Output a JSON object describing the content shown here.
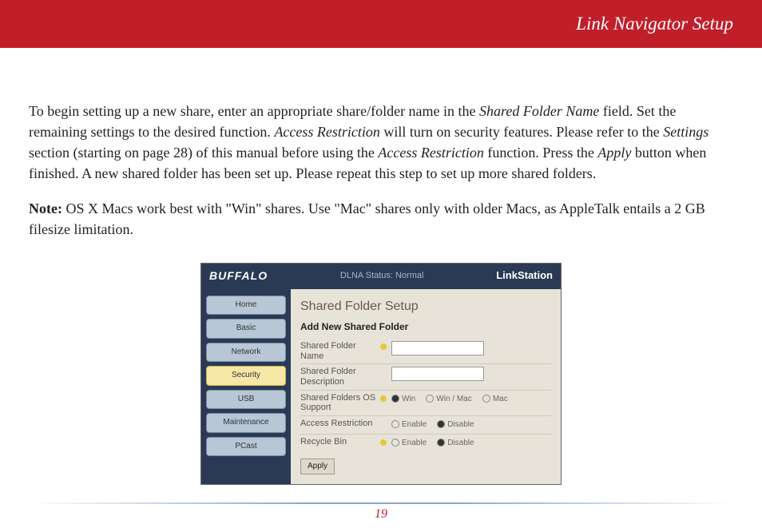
{
  "header": {
    "title": "Link Navigator Setup"
  },
  "body": {
    "p1a": "To begin setting up a new share, enter an appropriate share/folder name in the ",
    "p1_em1": "Shared Folder Name",
    "p1b": " field.   Set the remaining settings to the desired function.  ",
    "p1_em2": "Access Restriction",
    "p1c": " will turn on security features.  Please refer to the ",
    "p1_em3": "Settings",
    "p1d": " section (starting on page 28) of this manual before using the ",
    "p1_em4": "Access Restriction",
    "p1e": " function.  Press the ",
    "p1_em5": "Apply",
    "p1f": " button when finished.  A new shared folder has been set up.  Please repeat this step to set up more shared folders.",
    "note_label": "Note:",
    "note_text": "  OS X Macs work best with \"Win\" shares.  Use \"Mac\" shares only with older Macs, as AppleTalk entails a 2 GB filesize limitation."
  },
  "screenshot": {
    "brand": "BUFFALO",
    "status": "DLNA Status: Normal",
    "product": "LinkStation",
    "nav": {
      "home": "Home",
      "basic": "Basic",
      "network": "Network",
      "security": "Security",
      "usb": "USB",
      "maintenance": "Maintenance",
      "pcast": "PCast"
    },
    "panel_title": "Shared Folder Setup",
    "panel_subtitle": "Add New Shared Folder",
    "rows": {
      "r1": "Shared Folder Name",
      "r2": "Shared Folder Description",
      "r3": "Shared Folders OS Support",
      "r4": "Access Restriction",
      "r5": "Recycle Bin"
    },
    "opts": {
      "win": "Win",
      "winmac": "Win / Mac",
      "mac": "Mac",
      "enable": "Enable",
      "disable": "Disable"
    },
    "apply": "Apply"
  },
  "page_number": "19"
}
